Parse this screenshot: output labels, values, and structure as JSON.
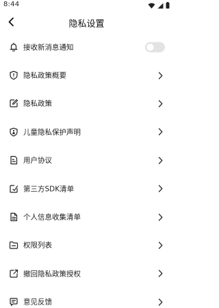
{
  "status_bar": {
    "time": "8:44",
    "icons": [
      "wifi-icon",
      "cellular-signal-icon",
      "battery-icon"
    ]
  },
  "header": {
    "title": "隐私设置",
    "back_icon": "chevron-left-icon"
  },
  "settings": {
    "notifications": {
      "label": "接收新消息通知",
      "icon": "bell-icon",
      "toggle_on": false
    },
    "items": [
      {
        "label": "隐私政策概要",
        "icon": "shield-icon"
      },
      {
        "label": "隐私政策",
        "icon": "edit-icon"
      },
      {
        "label": "儿童隐私保护声明",
        "icon": "child-shield-icon"
      },
      {
        "label": "用户协议",
        "icon": "document-icon"
      },
      {
        "label": "第三方SDK清单",
        "icon": "edit-check-icon"
      },
      {
        "label": "个人信息收集清单",
        "icon": "file-list-icon"
      },
      {
        "label": "权限列表",
        "icon": "folder-icon"
      },
      {
        "label": "撤回隐私政策授权",
        "icon": "external-link-icon"
      },
      {
        "label": "意见反馈",
        "icon": "feedback-icon"
      }
    ]
  },
  "colors": {
    "text": "#1f1f1f",
    "toggle_off": "#e3e3e3",
    "chevron": "#333333",
    "icon_stroke": "#222222"
  }
}
